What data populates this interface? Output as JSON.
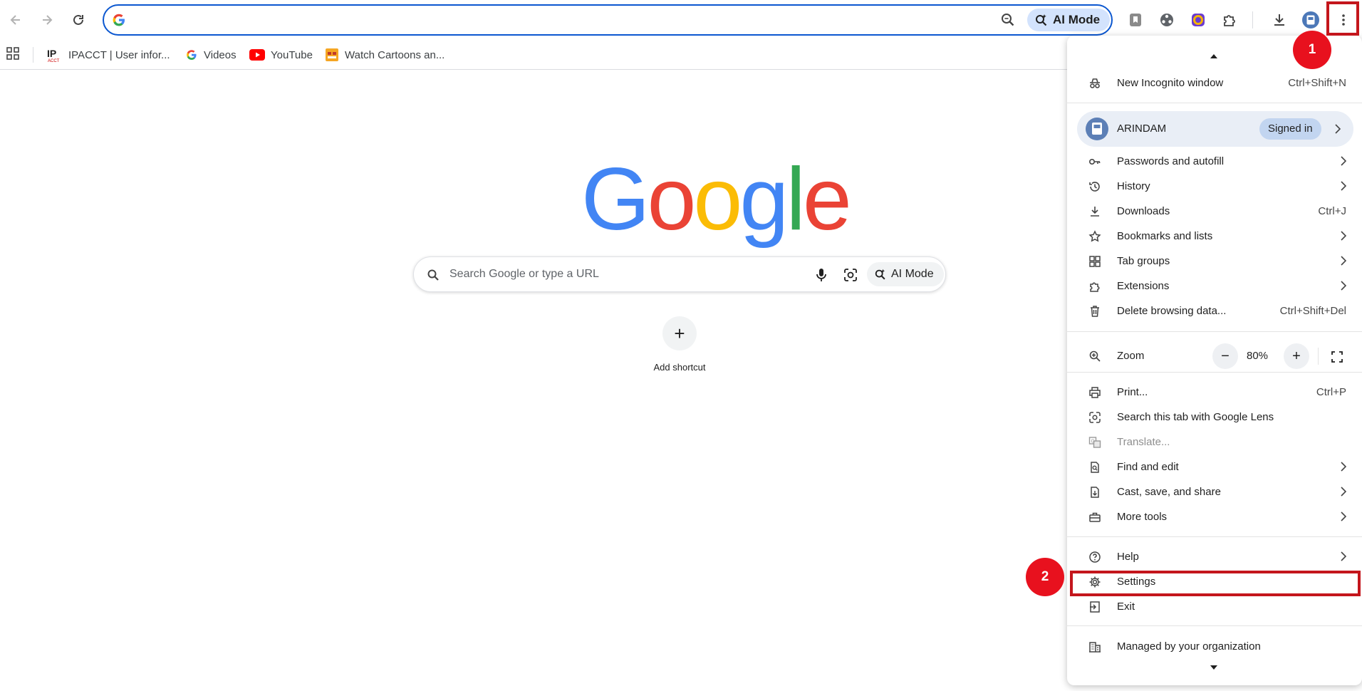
{
  "toolbar": {
    "back_icon": "arrow-left-icon",
    "forward_icon": "arrow-right-icon",
    "reload_icon": "reload-icon",
    "omnibox_value": "",
    "ai_mode_label": "AI Mode",
    "accent": "#0b57d0"
  },
  "bookmarks": {
    "items": [
      {
        "label": "IPACCT | User infor...",
        "icon": "ipacct-icon"
      },
      {
        "label": "Videos",
        "icon": "google-g-icon"
      },
      {
        "label": "YouTube",
        "icon": "youtube-icon"
      },
      {
        "label": "Watch Cartoons an...",
        "icon": "cartoon-icon"
      }
    ]
  },
  "ntp": {
    "logo_text": "Google",
    "search_placeholder": "Search Google or type a URL",
    "ai_mode_label": "AI Mode",
    "add_shortcut_label": "Add shortcut",
    "add_shortcut_symbol": "+"
  },
  "menu": {
    "new_incognito": {
      "label": "New Incognito window",
      "shortcut": "Ctrl+Shift+N"
    },
    "profile": {
      "name": "ARINDAM",
      "status": "Signed in"
    },
    "items_a": [
      {
        "label": "Passwords and autofill",
        "shortcut": ""
      },
      {
        "label": "History",
        "shortcut": ""
      },
      {
        "label": "Downloads",
        "shortcut": "Ctrl+J"
      },
      {
        "label": "Bookmarks and lists",
        "shortcut": ""
      },
      {
        "label": "Tab groups",
        "shortcut": ""
      },
      {
        "label": "Extensions",
        "shortcut": ""
      },
      {
        "label": "Delete browsing data...",
        "shortcut": "Ctrl+Shift+Del"
      }
    ],
    "zoom": {
      "label": "Zoom",
      "minus": "−",
      "value": "80%",
      "plus": "+"
    },
    "items_b": [
      {
        "label": "Print...",
        "shortcut": "Ctrl+P"
      },
      {
        "label": "Search this tab with Google Lens",
        "shortcut": ""
      },
      {
        "label": "Translate...",
        "shortcut": ""
      },
      {
        "label": "Find and edit",
        "shortcut": ""
      },
      {
        "label": "Cast, save, and share",
        "shortcut": ""
      },
      {
        "label": "More tools",
        "shortcut": ""
      }
    ],
    "help": "Help",
    "settings": "Settings",
    "exit": "Exit",
    "managed": "Managed by your organization"
  },
  "annotations": {
    "badge_1": "1",
    "badge_2": "2",
    "color": "#e8111e"
  }
}
